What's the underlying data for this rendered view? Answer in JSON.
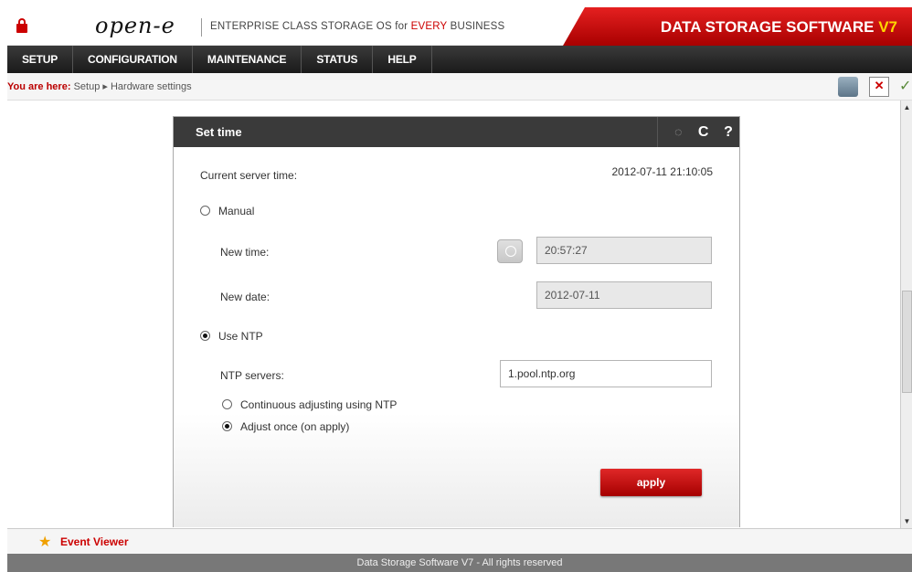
{
  "header": {
    "logo_text": "open-e",
    "tagline_pre": "ENTERPRISE CLASS STORAGE OS for ",
    "tagline_highlight": "EVERY",
    "tagline_post": " BUSINESS",
    "product_title": "DATA STORAGE SOFTWARE ",
    "product_version": "V7"
  },
  "nav": {
    "items": [
      "SETUP",
      "CONFIGURATION",
      "MAINTENANCE",
      "STATUS",
      "HELP"
    ]
  },
  "breadcrumb": {
    "lead": "You are here:",
    "path_root": "Setup",
    "separator": "▸",
    "path_current": "Hardware settings"
  },
  "panel": {
    "title": "Set time",
    "tools": {
      "refresh": "C",
      "help": "?"
    },
    "current_time_label": "Current server time:",
    "current_time_value": "2012-07-11 21:10:05",
    "manual_label": "Manual",
    "new_time_label": "New time:",
    "new_time_value": "20:57:27",
    "new_date_label": "New date:",
    "new_date_value": "2012-07-11",
    "use_ntp_label": "Use NTP",
    "ntp_servers_label": "NTP servers:",
    "ntp_servers_value": "1.pool.ntp.org",
    "continuous_label": "Continuous adjusting using NTP",
    "adjust_once_label": "Adjust once (on apply)",
    "apply_label": "apply"
  },
  "event_viewer": {
    "label": "Event Viewer"
  },
  "footer": {
    "text": "Data Storage Software V7 - All rights reserved"
  },
  "colors": {
    "brand_red": "#c00000",
    "header_dark": "#3a3a3a",
    "accent_yellow": "#ffd700"
  }
}
